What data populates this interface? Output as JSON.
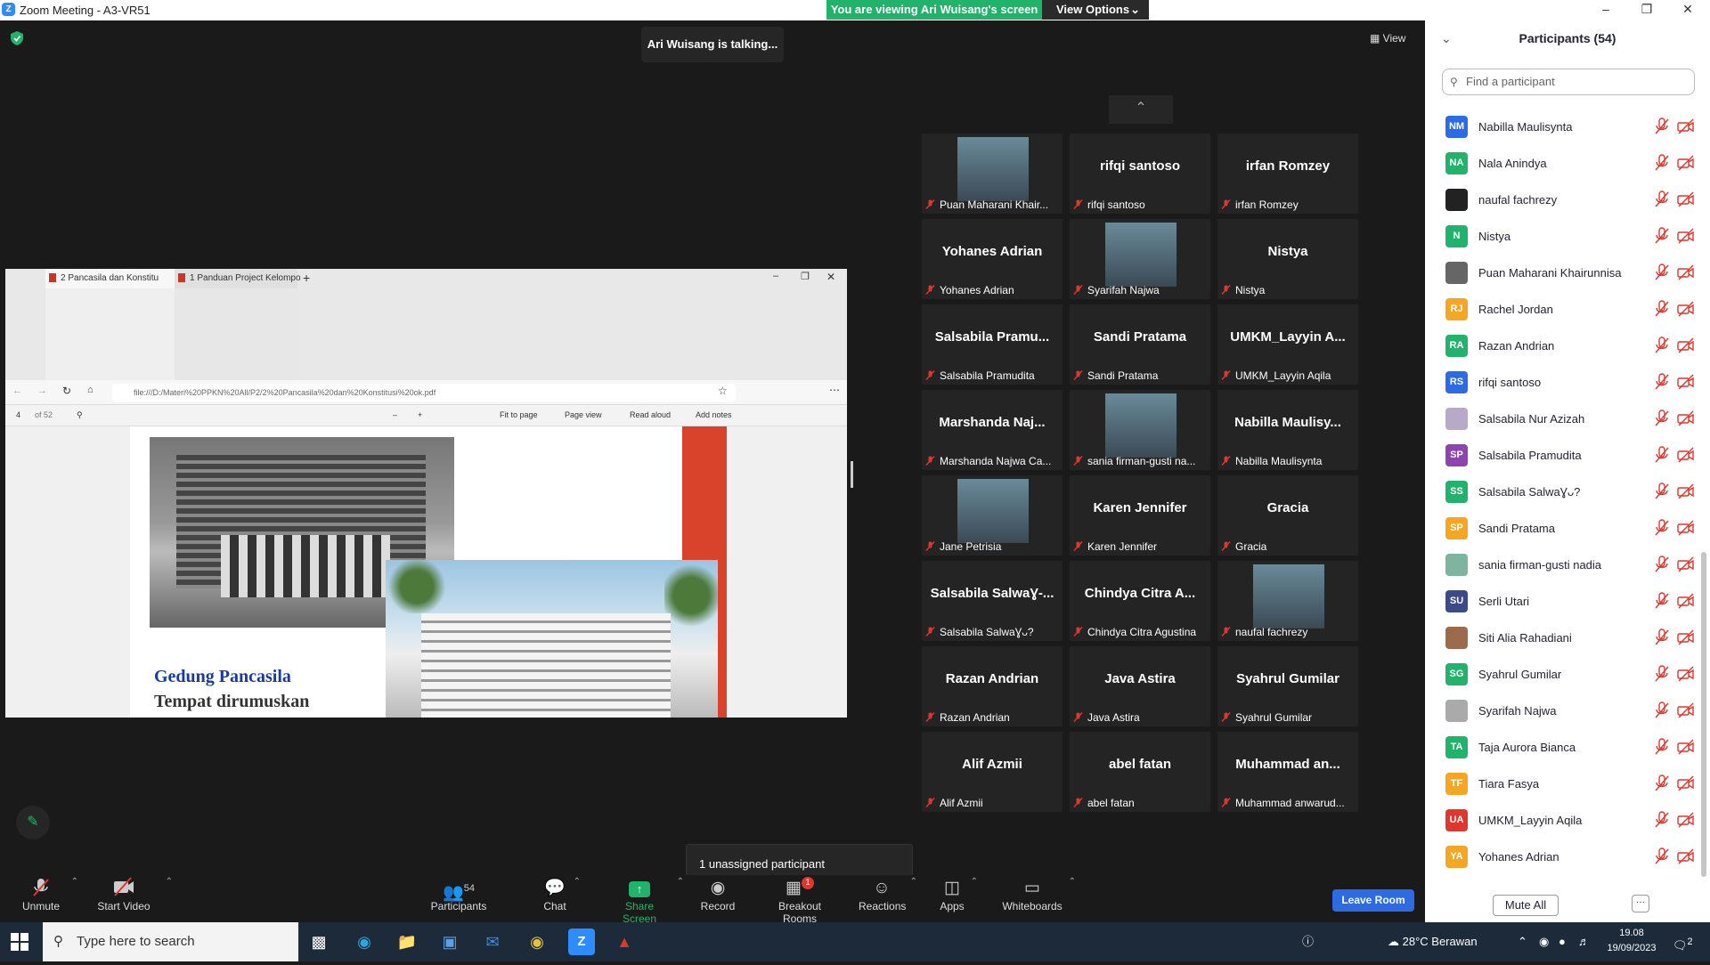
{
  "window": {
    "title": "Zoom Meeting - A3-VR51",
    "logo": "Z"
  },
  "share_banner": {
    "message": "You are viewing Ari Wuisang's screen",
    "view_options": "View Options"
  },
  "talking": "Ari Wuisang is talking...",
  "view_button": "View",
  "shared_screen": {
    "tabs": [
      "2 Pancasila dan Konstitu",
      "1 Panduan Project Kelompo"
    ],
    "url": "file:///D:/Materi%20PPKN%20All/P2/2%20Pancasila%20dan%20Konstitusi%20ok.pdf",
    "page_num": "4",
    "page_total": "of 52",
    "tools": [
      "Fit to page",
      "Page view",
      "Read aloud",
      "Add notes"
    ],
    "slide_title": "Gedung Pancasila",
    "slide_sub": "Tempat dirumuskan"
  },
  "tiles": [
    {
      "name": "",
      "label": "Puan Maharani Khair...",
      "photo": true
    },
    {
      "name": "rifqi santoso",
      "label": "rifqi santoso"
    },
    {
      "name": "irfan Romzey",
      "label": "irfan Romzey"
    },
    {
      "name": "Yohanes Adrian",
      "label": "Yohanes Adrian"
    },
    {
      "name": "",
      "label": "Syarifah Najwa",
      "photo": true
    },
    {
      "name": "Nistya",
      "label": "Nistya"
    },
    {
      "name": "Salsabila Pramu...",
      "label": "Salsabila Pramudita"
    },
    {
      "name": "Sandi Pratama",
      "label": "Sandi Pratama"
    },
    {
      "name": "UMKM_Layyin A...",
      "label": "UMKM_Layyin Aqila"
    },
    {
      "name": "Marshanda Naj...",
      "label": "Marshanda Najwa Ca..."
    },
    {
      "name": "",
      "label": "sania firman-gusti na...",
      "photo": true
    },
    {
      "name": "Nabilla Maulisy...",
      "label": "Nabilla Maulisynta"
    },
    {
      "name": "",
      "label": "Jane Petrisia",
      "photo": true
    },
    {
      "name": "Karen Jennifer",
      "label": "Karen Jennifer"
    },
    {
      "name": "Gracia",
      "label": "Gracia"
    },
    {
      "name": "Salsabila SalwaƔ-...",
      "label": "Salsabila SalwaƔᴗ?"
    },
    {
      "name": "Chindya Citra A...",
      "label": "Chindya Citra Agustina"
    },
    {
      "name": "",
      "label": "naufal fachrezy",
      "photo": true
    },
    {
      "name": "Razan Andrian",
      "label": "Razan Andrian"
    },
    {
      "name": "Java Astira",
      "label": "Java Astira"
    },
    {
      "name": "Syahrul Gumilar",
      "label": "Syahrul Gumilar"
    },
    {
      "name": "Alif Azmii",
      "label": "Alif Azmii"
    },
    {
      "name": "abel fatan",
      "label": "abel fatan"
    },
    {
      "name": "Muhammad an...",
      "label": "Muhammad anwarud..."
    }
  ],
  "unassigned": "1 unassigned participant",
  "toolbar": {
    "unmute": "Unmute",
    "start_video": "Start Video",
    "participants": "Participants",
    "participants_count": "54",
    "chat": "Chat",
    "share_screen": "Share Screen",
    "record": "Record",
    "breakout": "Breakout Rooms",
    "breakout_badge": "1",
    "reactions": "Reactions",
    "apps": "Apps",
    "whiteboards": "Whiteboards",
    "leave": "Leave Room"
  },
  "panel": {
    "title": "Participants (54)",
    "search_placeholder": "Find a participant",
    "mute_all": "Mute All",
    "more": "···",
    "participants": [
      {
        "initials": "NM",
        "name": "Nabilla Maulisynta",
        "color": "#2d6be4"
      },
      {
        "initials": "NA",
        "name": "Nala Anindya",
        "color": "#21b36b"
      },
      {
        "initials": "",
        "name": "naufal fachrezy",
        "color": "#222222"
      },
      {
        "initials": "N",
        "name": "Nistya",
        "color": "#21b36b"
      },
      {
        "initials": "",
        "name": "Puan Maharani Khairunnisa",
        "color": "#666666"
      },
      {
        "initials": "RJ",
        "name": "Rachel Jordan",
        "color": "#f5a623"
      },
      {
        "initials": "RA",
        "name": "Razan Andrian",
        "color": "#21b36b"
      },
      {
        "initials": "RS",
        "name": "rifqi santoso",
        "color": "#2d6be4"
      },
      {
        "initials": "",
        "name": "Salsabila Nur Azizah",
        "color": "#b8a9c9"
      },
      {
        "initials": "SP",
        "name": "Salsabila Pramudita",
        "color": "#8e44ad"
      },
      {
        "initials": "SS",
        "name": "Salsabila SalwaƔᴗ?",
        "color": "#21b36b"
      },
      {
        "initials": "SP",
        "name": "Sandi Pratama",
        "color": "#f5a623"
      },
      {
        "initials": "",
        "name": "sania firman-gusti nadia",
        "color": "#7fb5a0"
      },
      {
        "initials": "SU",
        "name": "Serli Utari",
        "color": "#3a4a8a"
      },
      {
        "initials": "",
        "name": "Siti Alia Rahadiani",
        "color": "#9c6b4e"
      },
      {
        "initials": "SG",
        "name": "Syahrul Gumilar",
        "color": "#21b36b"
      },
      {
        "initials": "",
        "name": "Syarifah Najwa",
        "color": "#aaaaaa"
      },
      {
        "initials": "TA",
        "name": "Taja Aurora Bianca",
        "color": "#21b36b"
      },
      {
        "initials": "TF",
        "name": "Tiara Fasya",
        "color": "#f5a623"
      },
      {
        "initials": "UA",
        "name": "UMKM_Layyin Aqila",
        "color": "#e0362c"
      },
      {
        "initials": "YA",
        "name": "Yohanes Adrian",
        "color": "#f5a623"
      }
    ]
  },
  "taskbar": {
    "search_placeholder": "Type here to search",
    "weather": "28°C Berawan",
    "time": "19.08",
    "date": "19/09/2023",
    "notif_count": "2",
    "weather_badge": "1"
  }
}
